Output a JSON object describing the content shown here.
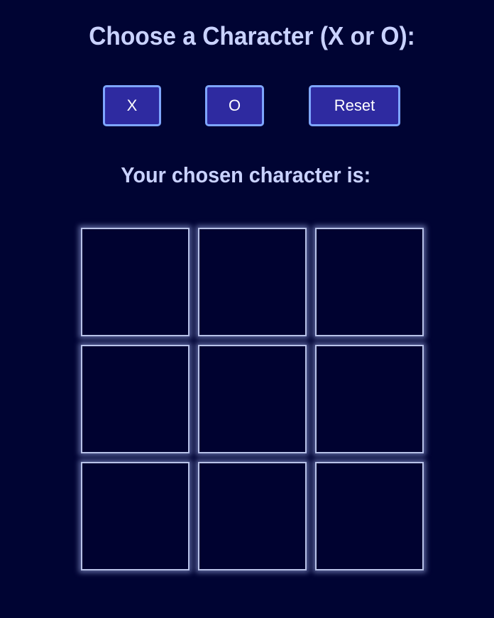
{
  "title": "Choose a Character (X or O):",
  "buttons": {
    "x_label": "X",
    "o_label": "O",
    "reset_label": "Reset"
  },
  "chosen": {
    "label": "Your chosen character is:",
    "value": ""
  },
  "board": {
    "cells": [
      "",
      "",
      "",
      "",
      "",
      "",
      "",
      "",
      ""
    ]
  },
  "colors": {
    "background": "#000433",
    "text": "#c9d2ff",
    "button_fill": "#2e2aa0",
    "button_border": "#7ea6ff",
    "cell_fill": "#000230",
    "cell_glow": "#b8c2e8"
  }
}
